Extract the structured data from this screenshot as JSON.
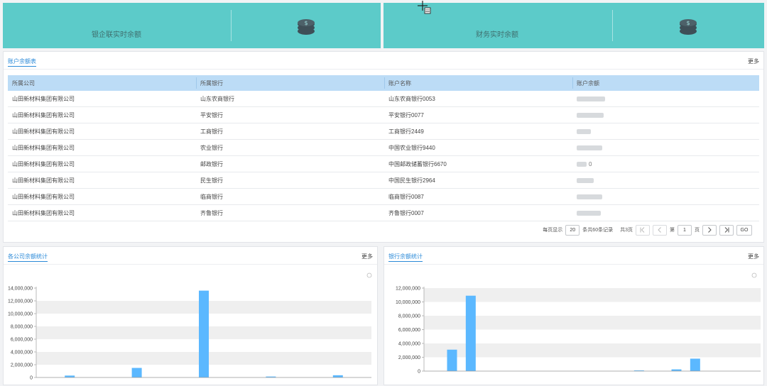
{
  "summary_cards": [
    {
      "label": "银企联实时余额",
      "icon": "coins-icon"
    },
    {
      "label": "财务实时余额",
      "icon": "coins-icon"
    }
  ],
  "account_table": {
    "title": "账户余额表",
    "more": "更多",
    "columns": [
      "所属公司",
      "所属银行",
      "账户名称",
      "账户余额"
    ],
    "rows": [
      {
        "company": "山田新材料集团有限公司",
        "bank": "山东农商银行",
        "account": "山东农商银行0053",
        "balance_partial": ""
      },
      {
        "company": "山田新材料集团有限公司",
        "bank": "平安银行",
        "account": "平安银行0077",
        "balance_partial": ""
      },
      {
        "company": "山田新材料集团有限公司",
        "bank": "工商银行",
        "account": "工商银行2449",
        "balance_partial": ""
      },
      {
        "company": "山田新材料集团有限公司",
        "bank": "农业银行",
        "account": "中国农业银行9440",
        "balance_partial": ""
      },
      {
        "company": "山田新材料集团有限公司",
        "bank": "邮政银行",
        "account": "中国邮政储蓄银行6670",
        "balance_partial": "0"
      },
      {
        "company": "山田新材料集团有限公司",
        "bank": "民生银行",
        "account": "中国民生银行2964",
        "balance_partial": ""
      },
      {
        "company": "山田新材料集团有限公司",
        "bank": "临商银行",
        "account": "临商银行0087",
        "balance_partial": ""
      },
      {
        "company": "山田新材料集团有限公司",
        "bank": "齐鲁银行",
        "account": "齐鲁银行0007",
        "balance_partial": ""
      }
    ],
    "pager": {
      "per_page_label": "每页显示",
      "per_page": "20",
      "total_label": "条共60条记录",
      "pages_label": "共3页",
      "page_prefix": "第",
      "page": "1",
      "page_suffix": "页",
      "go": "GO"
    }
  },
  "company_chart": {
    "title": "各公司余额统计",
    "more": "更多"
  },
  "bank_chart": {
    "title": "银行余额统计",
    "more": "更多"
  },
  "chart_data": [
    {
      "type": "bar",
      "title": "各公司余额统计",
      "color": "#5bb8ff",
      "ylim": [
        0,
        14000000
      ],
      "yticks": [
        "0",
        "2,000,000",
        "4,000,000",
        "6,000,000",
        "8,000,000",
        "10,000,000",
        "12,000,000",
        "14,000,000"
      ],
      "values": [
        300000,
        1500000,
        13600000,
        150000,
        350000
      ],
      "grid": "alternating bands"
    },
    {
      "type": "bar",
      "title": "银行余额统计",
      "color": "#5bb8ff",
      "ylim": [
        0,
        12000000
      ],
      "yticks": [
        "0",
        "2,000,000",
        "4,000,000",
        "6,000,000",
        "8,000,000",
        "10,000,000",
        "12,000,000"
      ],
      "values": [
        0,
        3100000,
        10900000,
        0,
        0,
        0,
        0,
        0,
        0,
        0,
        0,
        100000,
        0,
        250000,
        1800000,
        0,
        0,
        0
      ],
      "grid": "alternating bands"
    }
  ]
}
